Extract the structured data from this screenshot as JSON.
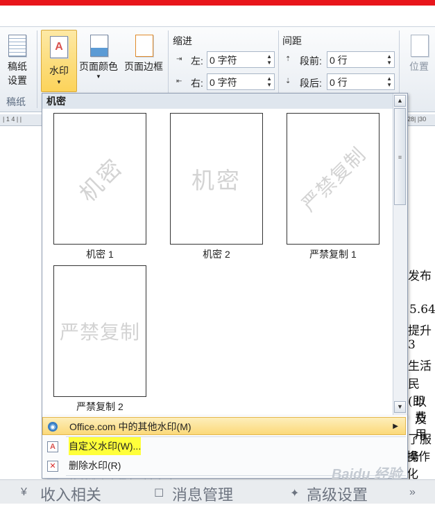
{
  "ribbon": {
    "manuscript": {
      "label_line1": "稿纸",
      "label_line2": "设置",
      "group": "稿纸"
    },
    "watermark": {
      "label": "水印"
    },
    "page_color": {
      "label": "页面颜色"
    },
    "page_border": {
      "label": "页面边框"
    },
    "indent": {
      "group": "缩进",
      "left_label": "左:",
      "left_value": "0 字符",
      "right_label": "右:",
      "right_value": "0 字符"
    },
    "spacing": {
      "group": "间距",
      "before_label": "段前:",
      "before_value": "0 行",
      "after_label": "段后:",
      "after_value": "0 行"
    },
    "position": {
      "label": "位置"
    }
  },
  "ruler": {
    "left_marks": "| 1 4 | |",
    "right_marks": "28| |30"
  },
  "document": {
    "lines": [
      "发布",
      "5.64",
      "提升 3",
      "生活",
      "民(即",
      "以及",
      "费用",
      "了服务",
      "操作化"
    ]
  },
  "gallery": {
    "header": "机密",
    "items": [
      {
        "caption": "机密 1",
        "watermark": "机密"
      },
      {
        "caption": "机密 2",
        "watermark": "机密"
      },
      {
        "caption": "严禁复制 1",
        "watermark": "严禁复制"
      },
      {
        "caption": "严禁复制 2",
        "watermark": "严禁复制"
      }
    ]
  },
  "menu": {
    "office": "Office.com 中的其他水印(M)",
    "custom": "自定义水印(W)...",
    "remove": "删除水印(R)",
    "save": "将所选内容保存到水印库(S)..."
  },
  "statusbar": {
    "item1": "收入相关",
    "item2": "消息管理",
    "item3": "高级设置"
  },
  "watermark_brand": "Baidu 经验",
  "colors": {
    "accent_red": "#e8161b",
    "highlight": "#ffff3a",
    "hover": "#fbd979"
  }
}
